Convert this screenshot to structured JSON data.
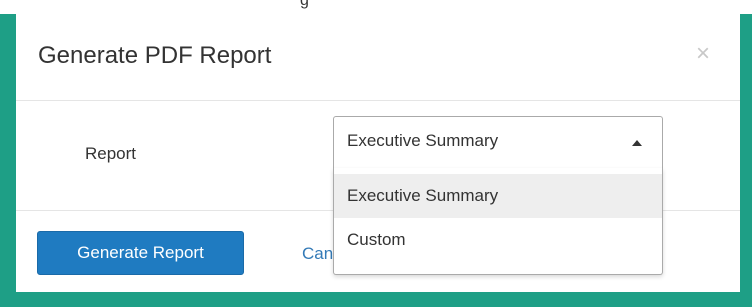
{
  "page_heading_fragment": "g",
  "modal": {
    "title": "Generate PDF Report",
    "close_glyph": "×"
  },
  "form": {
    "report_label": "Report",
    "report_select": {
      "selected_value": "Executive Summary",
      "expanded": true,
      "options": [
        {
          "label": "Executive Summary",
          "highlighted": true
        },
        {
          "label": "Custom",
          "highlighted": false
        }
      ]
    }
  },
  "footer": {
    "generate_label": "Generate Report",
    "cancel_label": "Canc"
  },
  "colors": {
    "frame": "#1e9f86",
    "primary_button": "#1f7bc1",
    "link": "#337ab7",
    "option_highlight": "#eeeeee"
  },
  "icons": {
    "close": "close-icon",
    "select_arrow": "caret-up-icon"
  }
}
